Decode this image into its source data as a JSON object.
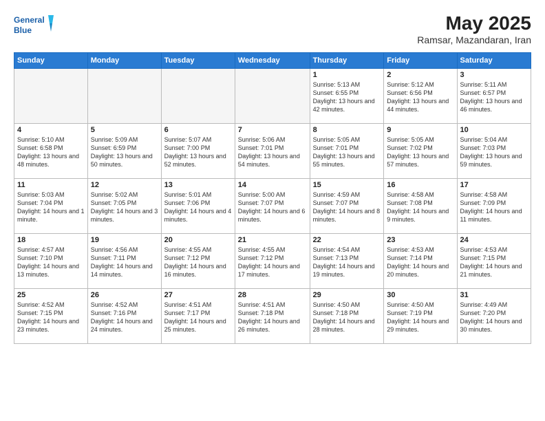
{
  "header": {
    "logo_line1": "General",
    "logo_line2": "Blue",
    "title": "May 2025",
    "subtitle": "Ramsar, Mazandaran, Iran"
  },
  "columns": [
    "Sunday",
    "Monday",
    "Tuesday",
    "Wednesday",
    "Thursday",
    "Friday",
    "Saturday"
  ],
  "weeks": [
    [
      {
        "day": "",
        "empty": true
      },
      {
        "day": "",
        "empty": true
      },
      {
        "day": "",
        "empty": true
      },
      {
        "day": "",
        "empty": true
      },
      {
        "day": "1",
        "sunrise": "5:13 AM",
        "sunset": "6:55 PM",
        "daylight": "13 hours and 42 minutes."
      },
      {
        "day": "2",
        "sunrise": "5:12 AM",
        "sunset": "6:56 PM",
        "daylight": "13 hours and 44 minutes."
      },
      {
        "day": "3",
        "sunrise": "5:11 AM",
        "sunset": "6:57 PM",
        "daylight": "13 hours and 46 minutes."
      }
    ],
    [
      {
        "day": "4",
        "sunrise": "5:10 AM",
        "sunset": "6:58 PM",
        "daylight": "13 hours and 48 minutes."
      },
      {
        "day": "5",
        "sunrise": "5:09 AM",
        "sunset": "6:59 PM",
        "daylight": "13 hours and 50 minutes."
      },
      {
        "day": "6",
        "sunrise": "5:07 AM",
        "sunset": "7:00 PM",
        "daylight": "13 hours and 52 minutes."
      },
      {
        "day": "7",
        "sunrise": "5:06 AM",
        "sunset": "7:01 PM",
        "daylight": "13 hours and 54 minutes."
      },
      {
        "day": "8",
        "sunrise": "5:05 AM",
        "sunset": "7:01 PM",
        "daylight": "13 hours and 55 minutes."
      },
      {
        "day": "9",
        "sunrise": "5:05 AM",
        "sunset": "7:02 PM",
        "daylight": "13 hours and 57 minutes."
      },
      {
        "day": "10",
        "sunrise": "5:04 AM",
        "sunset": "7:03 PM",
        "daylight": "13 hours and 59 minutes."
      }
    ],
    [
      {
        "day": "11",
        "sunrise": "5:03 AM",
        "sunset": "7:04 PM",
        "daylight": "14 hours and 1 minute."
      },
      {
        "day": "12",
        "sunrise": "5:02 AM",
        "sunset": "7:05 PM",
        "daylight": "14 hours and 3 minutes."
      },
      {
        "day": "13",
        "sunrise": "5:01 AM",
        "sunset": "7:06 PM",
        "daylight": "14 hours and 4 minutes."
      },
      {
        "day": "14",
        "sunrise": "5:00 AM",
        "sunset": "7:07 PM",
        "daylight": "14 hours and 6 minutes."
      },
      {
        "day": "15",
        "sunrise": "4:59 AM",
        "sunset": "7:07 PM",
        "daylight": "14 hours and 8 minutes."
      },
      {
        "day": "16",
        "sunrise": "4:58 AM",
        "sunset": "7:08 PM",
        "daylight": "14 hours and 9 minutes."
      },
      {
        "day": "17",
        "sunrise": "4:58 AM",
        "sunset": "7:09 PM",
        "daylight": "14 hours and 11 minutes."
      }
    ],
    [
      {
        "day": "18",
        "sunrise": "4:57 AM",
        "sunset": "7:10 PM",
        "daylight": "14 hours and 13 minutes."
      },
      {
        "day": "19",
        "sunrise": "4:56 AM",
        "sunset": "7:11 PM",
        "daylight": "14 hours and 14 minutes."
      },
      {
        "day": "20",
        "sunrise": "4:55 AM",
        "sunset": "7:12 PM",
        "daylight": "14 hours and 16 minutes."
      },
      {
        "day": "21",
        "sunrise": "4:55 AM",
        "sunset": "7:12 PM",
        "daylight": "14 hours and 17 minutes."
      },
      {
        "day": "22",
        "sunrise": "4:54 AM",
        "sunset": "7:13 PM",
        "daylight": "14 hours and 19 minutes."
      },
      {
        "day": "23",
        "sunrise": "4:53 AM",
        "sunset": "7:14 PM",
        "daylight": "14 hours and 20 minutes."
      },
      {
        "day": "24",
        "sunrise": "4:53 AM",
        "sunset": "7:15 PM",
        "daylight": "14 hours and 21 minutes."
      }
    ],
    [
      {
        "day": "25",
        "sunrise": "4:52 AM",
        "sunset": "7:15 PM",
        "daylight": "14 hours and 23 minutes."
      },
      {
        "day": "26",
        "sunrise": "4:52 AM",
        "sunset": "7:16 PM",
        "daylight": "14 hours and 24 minutes."
      },
      {
        "day": "27",
        "sunrise": "4:51 AM",
        "sunset": "7:17 PM",
        "daylight": "14 hours and 25 minutes."
      },
      {
        "day": "28",
        "sunrise": "4:51 AM",
        "sunset": "7:18 PM",
        "daylight": "14 hours and 26 minutes."
      },
      {
        "day": "29",
        "sunrise": "4:50 AM",
        "sunset": "7:18 PM",
        "daylight": "14 hours and 28 minutes."
      },
      {
        "day": "30",
        "sunrise": "4:50 AM",
        "sunset": "7:19 PM",
        "daylight": "14 hours and 29 minutes."
      },
      {
        "day": "31",
        "sunrise": "4:49 AM",
        "sunset": "7:20 PM",
        "daylight": "14 hours and 30 minutes."
      }
    ]
  ],
  "labels": {
    "sunrise": "Sunrise:",
    "sunset": "Sunset:",
    "daylight": "Daylight:"
  }
}
